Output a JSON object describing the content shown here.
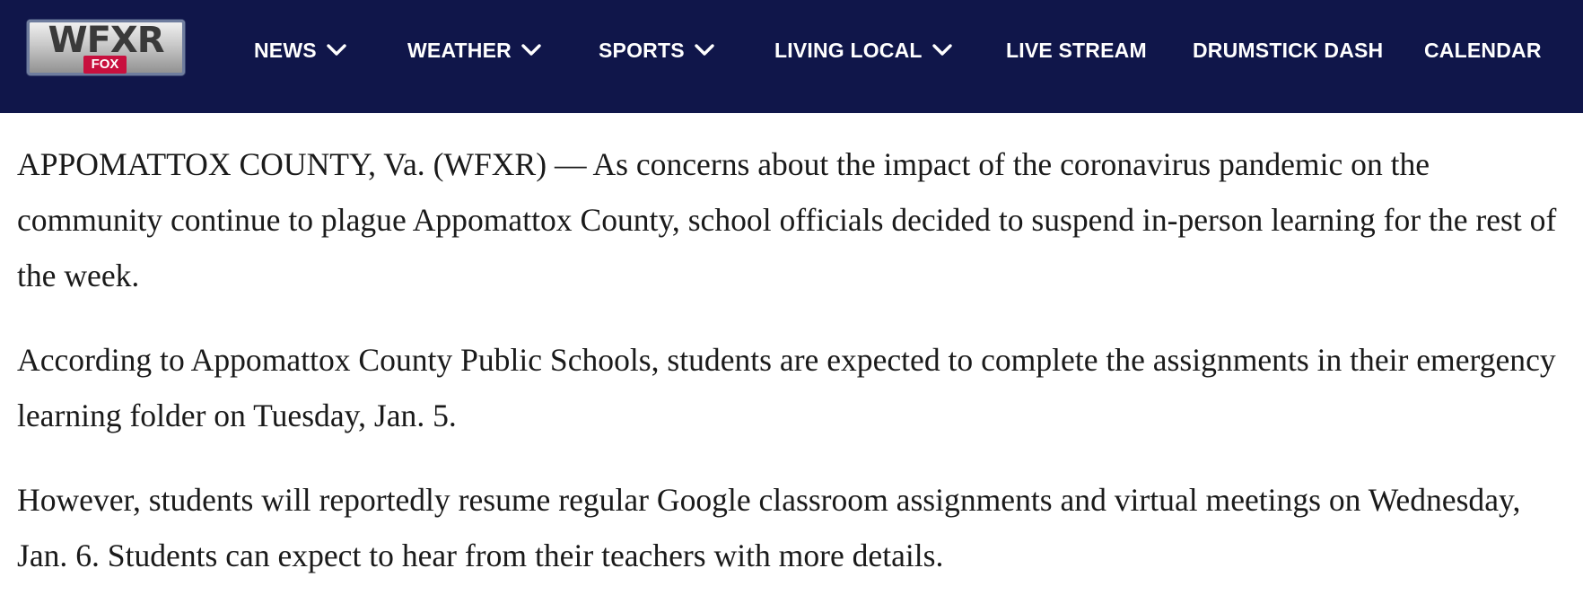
{
  "header": {
    "logo": {
      "text": "WFXR",
      "badge": "FOX"
    },
    "nav": [
      {
        "label": "NEWS",
        "has_dropdown": true
      },
      {
        "label": "WEATHER",
        "has_dropdown": true
      },
      {
        "label": "SPORTS",
        "has_dropdown": true
      },
      {
        "label": "LIVING LOCAL",
        "has_dropdown": true
      },
      {
        "label": "LIVE STREAM",
        "has_dropdown": false
      },
      {
        "label": "DRUMSTICK DASH",
        "has_dropdown": false
      },
      {
        "label": "CALENDAR",
        "has_dropdown": false
      }
    ],
    "icon": "chevron-down-icon",
    "colors": {
      "background": "#10164a",
      "badge": "#c8103e",
      "text": "#ffffff"
    }
  },
  "article": {
    "paragraphs": [
      "APPOMATTOX COUNTY, Va. (WFXR) — As concerns about the impact of the coronavirus pandemic on the community continue to plague Appomattox County, school officials decided to suspend in-person learning for the rest of the week.",
      "According to Appomattox County Public Schools, students are expected to complete the assignments in their emergency learning folder on Tuesday, Jan. 5.",
      "However, students will reportedly resume regular Google classroom assignments and virtual meetings on Wednesday, Jan. 6. Students can expect to hear from their teachers with more details."
    ]
  }
}
